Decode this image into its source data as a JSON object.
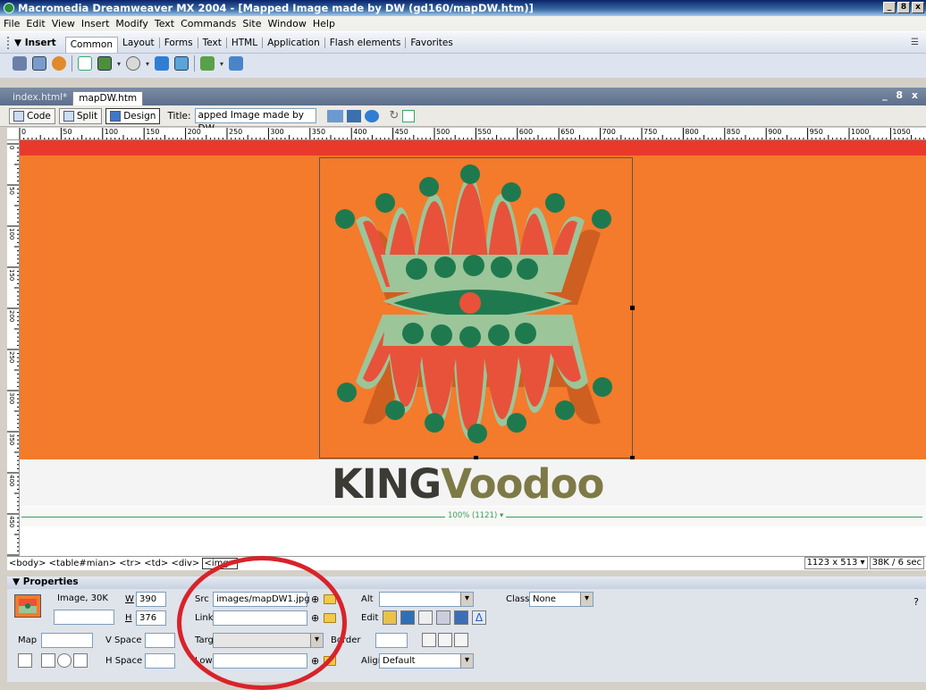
{
  "window": {
    "title": "Macromedia Dreamweaver MX 2004 - [Mapped Image made by DW (gd160/mapDW.htm)]",
    "controls": [
      "_",
      "8",
      "x"
    ]
  },
  "menu": [
    "File",
    "Edit",
    "View",
    "Insert",
    "Modify",
    "Text",
    "Commands",
    "Site",
    "Window",
    "Help"
  ],
  "insert_bar": {
    "label": "▼ Insert",
    "tabs": [
      "Common",
      "Layout",
      "Forms",
      "Text",
      "HTML",
      "Application",
      "Flash elements",
      "Favorites"
    ],
    "active_tab": "Common"
  },
  "document": {
    "tabs": [
      "index.html*",
      "mapDW.htm"
    ],
    "active_tab": "mapDW.htm",
    "window_controls": "_ 8 x",
    "view_buttons": [
      "Code",
      "Split",
      "Design"
    ],
    "title_label": "Title:",
    "title_value": "apped Image made by DW"
  },
  "ruler": {
    "h_labels": [
      "0",
      "50",
      "100",
      "150",
      "200",
      "250",
      "300",
      "350",
      "400",
      "450",
      "500",
      "550",
      "600",
      "650",
      "700",
      "750",
      "800",
      "850",
      "900",
      "950",
      "1000",
      "1050",
      "1100"
    ],
    "v_labels": [
      "0",
      "50",
      "100",
      "150",
      "200",
      "250",
      "300",
      "350",
      "400",
      "450",
      "500"
    ]
  },
  "design": {
    "logo_part1": "KING",
    "logo_part2": "Voodoo",
    "width_indicator": "100% (1121) ▾"
  },
  "tag_selector": {
    "path": "<body> <table#mian> <tr> <td> <div> ",
    "selected": "<img>",
    "window_size": "1123 x 513 ▾",
    "download": "38K / 6 sec"
  },
  "properties": {
    "header": "▼ Properties",
    "type": "Image, 30K",
    "w_label": "W",
    "w_value": "390",
    "h_label": "H",
    "h_value": "376",
    "src_label": "Src",
    "src_value": "images/mapDW1.jpg",
    "link_label": "Link",
    "link_value": "",
    "alt_label": "Alt",
    "alt_value": "",
    "class_label": "Class",
    "class_value": "None",
    "edit_label": "Edit",
    "map_label": "Map",
    "vspace_label": "V Space",
    "target_label": "Target",
    "border_label": "Border",
    "hspace_label": "H Space",
    "lowsrc_label": "Low Src",
    "align_label": "Align",
    "align_value": "Default"
  },
  "colors": {
    "page_orange": "#f47a2c",
    "crown_red": "#e8523a",
    "crown_green": "#1e7a4e",
    "crown_sage": "#9cc59a",
    "annotation_red": "#d8232a"
  }
}
